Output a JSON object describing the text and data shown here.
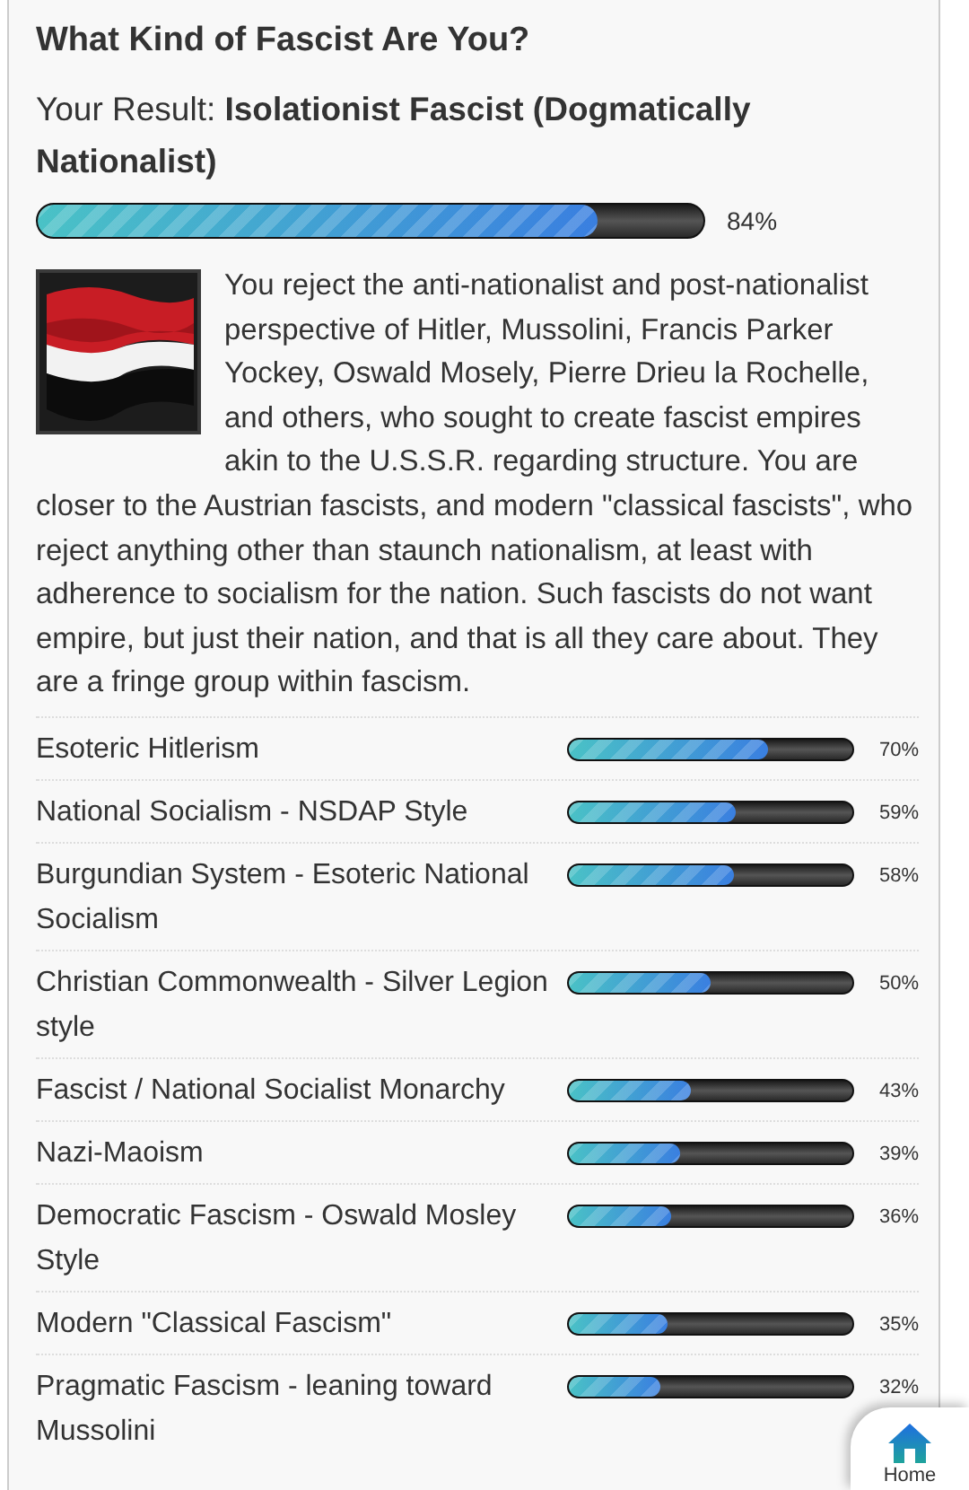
{
  "title": "What Kind of Fascist Are You?",
  "result": {
    "label": "Your Result:",
    "name": "Isolationist Fascist (Dogmatically Nationalist)",
    "level": 0.84,
    "percent": "84%"
  },
  "description": "You reject the anti-nationalist and post-nationalist perspective of Hitler, Mussolini, Francis Parker Yockey, Oswald Mosely, Pierre Drieu la Rochelle, and others, who sought to create fascist empires akin to the U.S.S.R. regarding structure. You are closer to the Austrian fascists, and modern \"classical fascists\", who reject anything other than staunch nationalism, at least with adherence to socialism for the nation. Such fascists do not want empire, but just their nation, and that is all they care about. They are a fringe group within fascism.",
  "results": [
    {
      "name": "Esoteric Hitlerism",
      "level": 0.7,
      "percent": "70%"
    },
    {
      "name": "National Socialism - NSDAP Style",
      "level": 0.59,
      "percent": "59%"
    },
    {
      "name": "Burgundian System - Esoteric National Socialism",
      "level": 0.58,
      "percent": "58%"
    },
    {
      "name": "Christian Commonwealth - Silver Legion style",
      "level": 0.5,
      "percent": "50%"
    },
    {
      "name": "Fascist / National Socialist Monarchy",
      "level": 0.43,
      "percent": "43%"
    },
    {
      "name": "Nazi-Maoism",
      "level": 0.39,
      "percent": "39%"
    },
    {
      "name": "Democratic Fascism - Oswald Mosley Style",
      "level": 0.36,
      "percent": "36%"
    },
    {
      "name": "Modern \"Classical Fascism\"",
      "level": 0.35,
      "percent": "35%"
    },
    {
      "name": "Pragmatic Fascism - leaning toward Mussolini",
      "level": 0.32,
      "percent": "32%"
    }
  ],
  "home_button": {
    "label": "Home"
  }
}
